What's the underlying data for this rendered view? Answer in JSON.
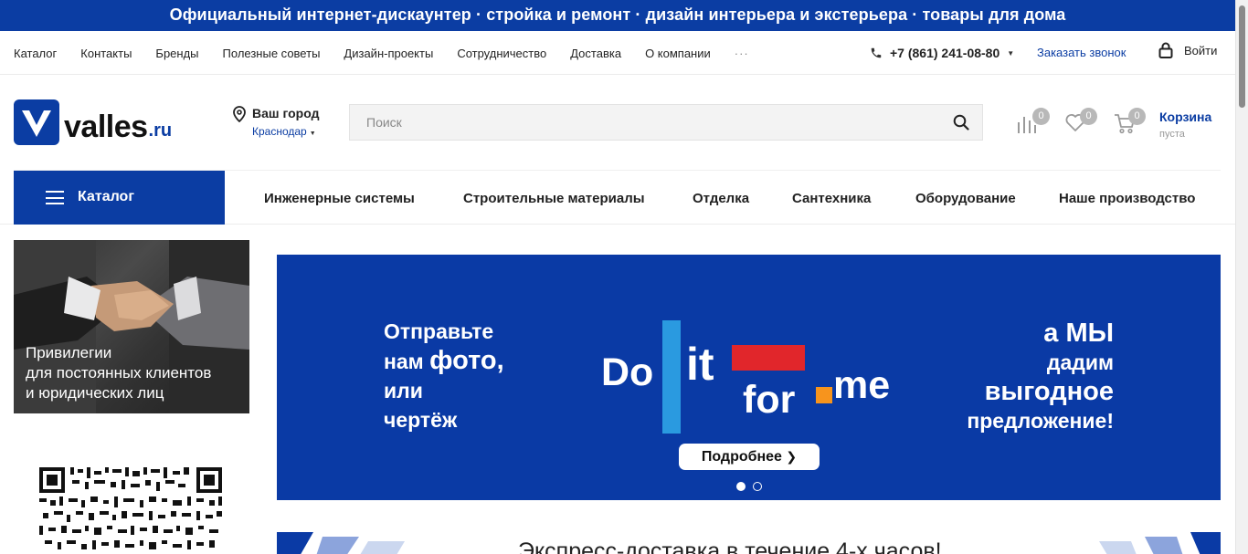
{
  "banner": {
    "text": "Официальный интернет-дискаунтер · стройка и ремонт · дизайн интерьера и экстерьера · товары для дома"
  },
  "topnav": {
    "links": [
      "Каталог",
      "Контакты",
      "Бренды",
      "Полезные советы",
      "Дизайн-проекты",
      "Сотрудничество",
      "Доставка",
      "О компании"
    ],
    "more": "···",
    "phone": "+7 (861) 241-08-80",
    "callback": "Заказать звонок",
    "login": "Войти"
  },
  "header": {
    "logo_text": "valles",
    "logo_suffix": ".ru",
    "city_label": "Ваш город",
    "city_value": "Краснодар",
    "search_placeholder": "Поиск",
    "compare_count": "0",
    "favorites_count": "0",
    "cart_count": "0",
    "cart_title": "Корзина",
    "cart_status": "пуста"
  },
  "mainnav": {
    "catalog_label": "Каталог",
    "items": [
      "Инженерные системы",
      "Строительные материалы",
      "Отделка",
      "Сантехника",
      "Оборудование",
      "Наше производство"
    ]
  },
  "promo": {
    "line1": "Привилегии",
    "line2": "для постоянных клиентов",
    "line3": "и юридических лиц"
  },
  "hero": {
    "left_line1": "Отправьте",
    "left_line2a": "нам",
    "left_line2b": "фото,",
    "left_line3": "или",
    "left_line4": "чертёж",
    "logo_do": "Do",
    "logo_it": "it",
    "logo_for": "for",
    "logo_me": "me",
    "right_line1": "а МЫ",
    "right_line2": "дадим",
    "right_line3": "выгодное",
    "right_line4": "предложение!",
    "cta": "Подробнее",
    "slides_total": 2,
    "slide_active": 1
  },
  "express": {
    "text": "Экспресс-доставка в течение 4-х часов!"
  },
  "colors": {
    "brand_blue": "#0b3da3",
    "hero_blue": "#0a3aa5",
    "accent_red": "#e1262b",
    "accent_orange": "#f7941d",
    "accent_light_blue": "#2a9ae0",
    "badge_gray": "#b8b8b8"
  }
}
